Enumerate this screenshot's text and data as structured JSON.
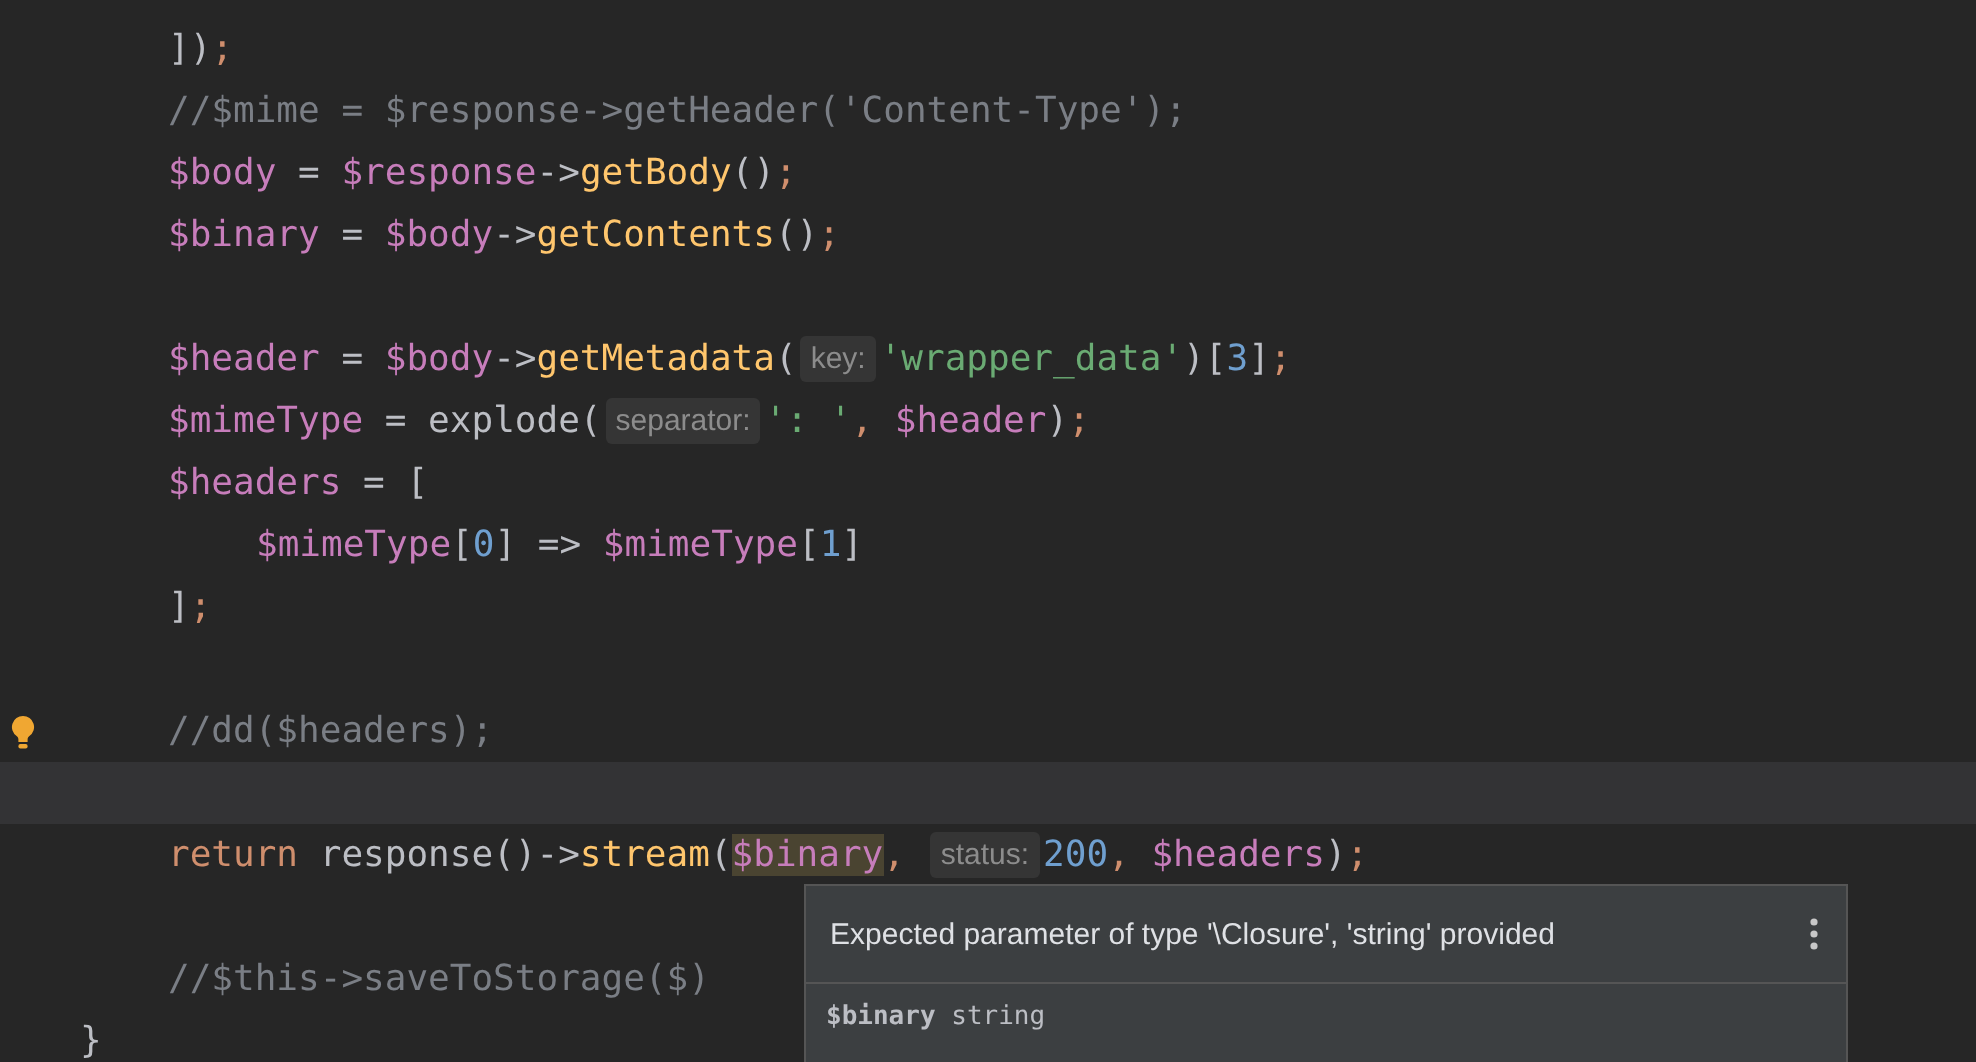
{
  "editor": {
    "lines": [
      {
        "kind": "code",
        "tokens": [
          {
            "kind": "plain",
            "text": "])"
          },
          {
            "kind": "punct",
            "text": ";"
          }
        ]
      },
      {
        "kind": "code",
        "tokens": [
          {
            "kind": "comment",
            "text": "//$mime = $response->getHeader('Content-Type');"
          }
        ]
      },
      {
        "kind": "code",
        "tokens": [
          {
            "kind": "var",
            "text": "$body"
          },
          {
            "kind": "plain",
            "text": " = "
          },
          {
            "kind": "var",
            "text": "$response"
          },
          {
            "kind": "plain",
            "text": "->"
          },
          {
            "kind": "fn",
            "text": "getBody"
          },
          {
            "kind": "plain",
            "text": "()"
          },
          {
            "kind": "punct",
            "text": ";"
          }
        ]
      },
      {
        "kind": "code",
        "tokens": [
          {
            "kind": "var",
            "text": "$binary"
          },
          {
            "kind": "plain",
            "text": " = "
          },
          {
            "kind": "var",
            "text": "$body"
          },
          {
            "kind": "plain",
            "text": "->"
          },
          {
            "kind": "fn",
            "text": "getContents"
          },
          {
            "kind": "plain",
            "text": "()"
          },
          {
            "kind": "punct",
            "text": ";"
          }
        ]
      },
      {
        "kind": "blank"
      },
      {
        "kind": "code",
        "tokens": [
          {
            "kind": "var",
            "text": "$header"
          },
          {
            "kind": "plain",
            "text": " = "
          },
          {
            "kind": "var",
            "text": "$body"
          },
          {
            "kind": "plain",
            "text": "->"
          },
          {
            "kind": "fn",
            "text": "getMetadata"
          },
          {
            "kind": "plain",
            "text": "("
          },
          {
            "kind": "hint",
            "text": "key:"
          },
          {
            "kind": "str",
            "text": "'wrapper_data'"
          },
          {
            "kind": "plain",
            "text": ")["
          },
          {
            "kind": "num",
            "text": "3"
          },
          {
            "kind": "plain",
            "text": "]"
          },
          {
            "kind": "punct",
            "text": ";"
          }
        ]
      },
      {
        "kind": "code",
        "tokens": [
          {
            "kind": "var",
            "text": "$mimeType"
          },
          {
            "kind": "plain",
            "text": " = explode("
          },
          {
            "kind": "hint",
            "text": "separator:"
          },
          {
            "kind": "str",
            "text": "': '"
          },
          {
            "kind": "punct",
            "text": ", "
          },
          {
            "kind": "var",
            "text": "$header"
          },
          {
            "kind": "plain",
            "text": ")"
          },
          {
            "kind": "punct",
            "text": ";"
          }
        ]
      },
      {
        "kind": "code",
        "tokens": [
          {
            "kind": "var",
            "text": "$headers"
          },
          {
            "kind": "plain",
            "text": " = ["
          }
        ]
      },
      {
        "kind": "code",
        "indent": true,
        "tokens": [
          {
            "kind": "var",
            "text": "$mimeType"
          },
          {
            "kind": "plain",
            "text": "["
          },
          {
            "kind": "num",
            "text": "0"
          },
          {
            "kind": "plain",
            "text": "] => "
          },
          {
            "kind": "var",
            "text": "$mimeType"
          },
          {
            "kind": "plain",
            "text": "["
          },
          {
            "kind": "num",
            "text": "1"
          },
          {
            "kind": "plain",
            "text": "]"
          }
        ]
      },
      {
        "kind": "code",
        "tokens": [
          {
            "kind": "plain",
            "text": "]"
          },
          {
            "kind": "punct",
            "text": ";"
          }
        ]
      },
      {
        "kind": "blank"
      },
      {
        "kind": "code",
        "bulb": true,
        "tokens": [
          {
            "kind": "comment",
            "text": "//dd($headers);"
          }
        ]
      },
      {
        "kind": "blank",
        "current": true
      },
      {
        "kind": "code",
        "tokens": [
          {
            "kind": "kw",
            "text": "return "
          },
          {
            "kind": "plain",
            "text": "response()->"
          },
          {
            "kind": "fn",
            "text": "stream"
          },
          {
            "kind": "plain",
            "text": "("
          },
          {
            "kind": "var",
            "text": "$binary",
            "highlighted": true
          },
          {
            "kind": "punct",
            "text": ", "
          },
          {
            "kind": "hint",
            "text": "status:"
          },
          {
            "kind": "num",
            "text": "200"
          },
          {
            "kind": "punct",
            "text": ", "
          },
          {
            "kind": "var",
            "text": "$headers"
          },
          {
            "kind": "plain",
            "text": ")"
          },
          {
            "kind": "punct",
            "text": ";"
          }
        ]
      },
      {
        "kind": "blank"
      },
      {
        "kind": "code",
        "tokens": [
          {
            "kind": "comment",
            "text": "//$this->saveToStorage($)"
          }
        ]
      },
      {
        "kind": "code",
        "outdent": true,
        "tokens": [
          {
            "kind": "plain",
            "text": "}"
          }
        ]
      }
    ]
  },
  "tooltip": {
    "message": "Expected parameter of type '\\Closure', 'string' provided",
    "signature_name": "$binary",
    "signature_type": "string"
  }
}
